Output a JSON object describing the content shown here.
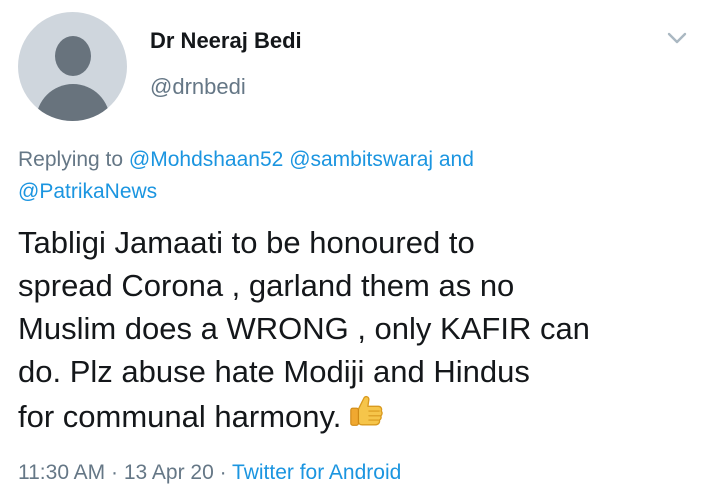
{
  "tweet": {
    "author": {
      "display_name": "Dr Neeraj Bedi",
      "handle": "@drnbedi"
    },
    "reply_context": {
      "prefix": "Replying to ",
      "mentions": [
        "@Mohdshaan52",
        "@sambitswaraj",
        "@PatrikaNews"
      ],
      "joiner": " and"
    },
    "text_lines": [
      "Tabligi Jamaati to be honoured to",
      "spread Corona , garland them as no",
      "Muslim does a WRONG , only KAFIR can",
      "do. Plz abuse hate Modiji and Hindus",
      "for communal harmony."
    ],
    "emoji": "thumbs-up-icon",
    "meta": {
      "time": "11:30 AM",
      "separator": " · ",
      "date": "13 Apr 20",
      "source": "Twitter for Android"
    }
  },
  "colors": {
    "primary_text": "#14171a",
    "secondary_text": "#657786",
    "link": "#1b95e0",
    "avatar_bg": "#cfd6dd",
    "avatar_fg": "#68737d"
  }
}
